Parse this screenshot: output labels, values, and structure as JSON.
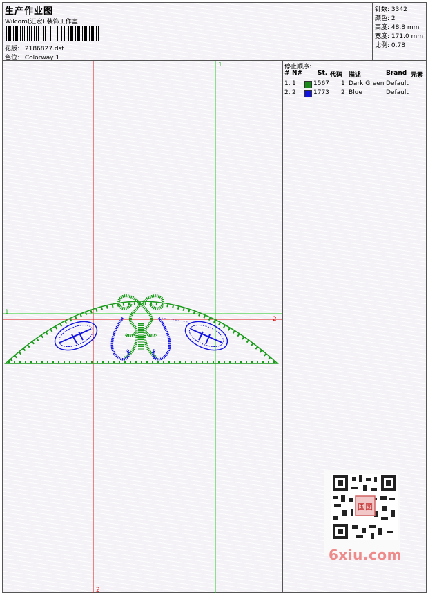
{
  "header": {
    "title": "生产作业图",
    "company": "Wilcom(汇宏) 装饰工作室",
    "design_label": "花版:",
    "design_value": "2186827.dst",
    "colorway_label": "色位:",
    "colorway_value": "Colorway 1"
  },
  "stats": [
    {
      "label": "针数",
      "value": "3342"
    },
    {
      "label": "颜色",
      "value": "2"
    },
    {
      "label": "高度",
      "value": "48.8 mm"
    },
    {
      "label": "宽度",
      "value": "171.0 mm"
    },
    {
      "label": "比例",
      "value": "0.78"
    }
  ],
  "guides": {
    "v1_top": "1",
    "v2_bottom": "2",
    "h1_left": "1",
    "h2_right": "2"
  },
  "stop_sequence": {
    "heading": "停止顺序:",
    "columns": [
      "#",
      "N#",
      "St.",
      "代码",
      "描述",
      "Brand",
      "元素"
    ],
    "rows": [
      {
        "idx": "1.",
        "num": "1",
        "color": "#1a8a1a",
        "stitches": "1567",
        "code": "1",
        "desc": "Dark Green",
        "brand": "Default"
      },
      {
        "idx": "2.",
        "num": "2",
        "color": "#1414e0",
        "stitches": "1773",
        "code": "2",
        "desc": "Blue",
        "brand": "Default"
      }
    ]
  },
  "watermark": {
    "text": "6xiu.com",
    "seal": "国图",
    "qr_icon": "qr-code-icon"
  },
  "colors": {
    "green": "#1a9a1a",
    "blue": "#1414e0",
    "guide_red": "#e01010",
    "guide_green": "#22cc22"
  }
}
